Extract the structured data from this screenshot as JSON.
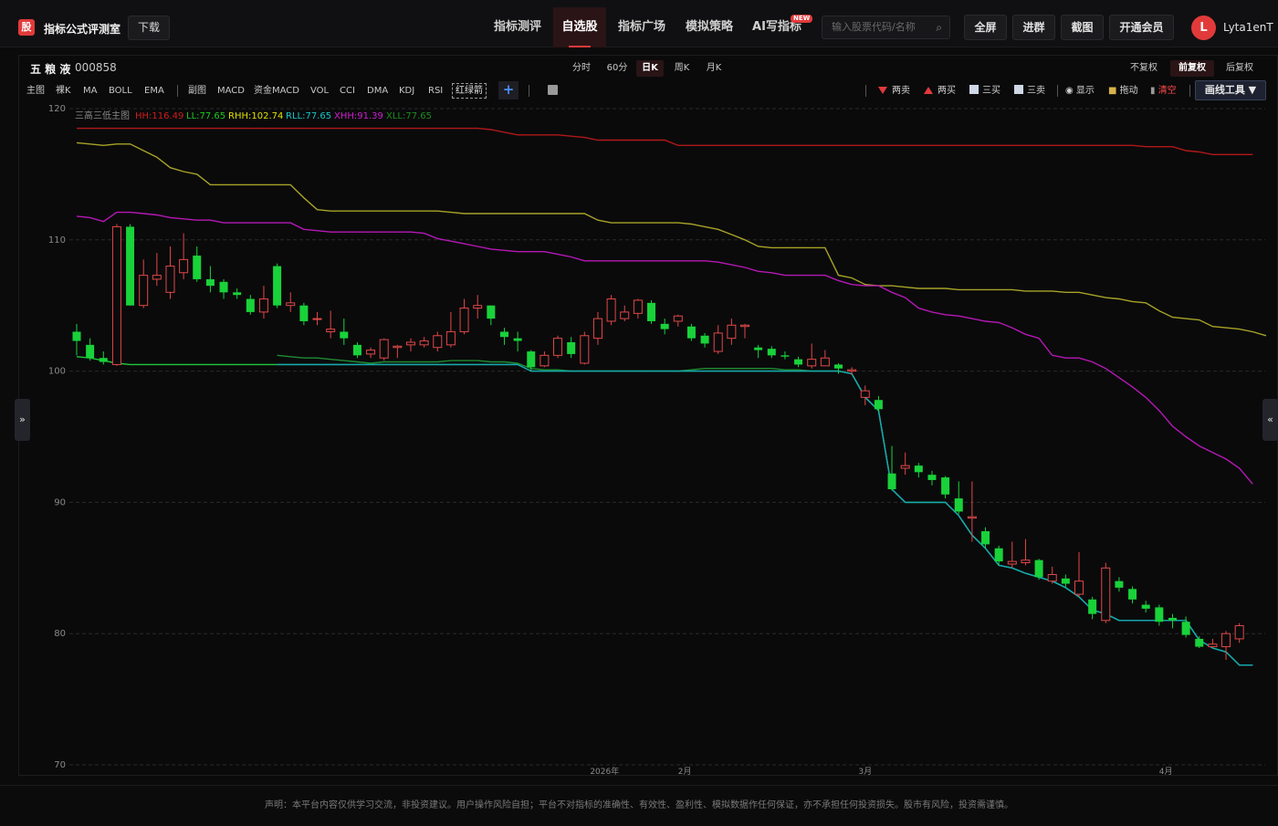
{
  "app": {
    "brand": "指标公式评测室",
    "logo_char": "股",
    "download": "下载"
  },
  "nav": [
    "指标测评",
    "自选股",
    "指标广场",
    "模拟策略",
    "AI写指标"
  ],
  "nav_active": "自选股",
  "new_badge": "NEW",
  "search": {
    "placeholder": "输入股票代码/名称"
  },
  "top_buttons": [
    "全屏",
    "进群",
    "截图",
    "开通会员"
  ],
  "user": {
    "avatar": "L",
    "name": "Lyta1enT"
  },
  "stock": {
    "name": "五 粮 液",
    "code": "000858"
  },
  "periods": [
    "分时",
    "60分",
    "日K",
    "周K",
    "月K"
  ],
  "period_active": "日K",
  "adjust": [
    "不复权",
    "前复权",
    "后复权"
  ],
  "adjust_active": "前复权",
  "indicators": [
    "主图",
    "裸K",
    "MA",
    "BOLL",
    "EMA",
    "副图",
    "MACD",
    "资金MACD",
    "VOL",
    "CCI",
    "DMA",
    "KDJ",
    "RSI",
    "红绿箭"
  ],
  "signals": [
    "两卖",
    "两买",
    "三买",
    "三卖",
    "显示",
    "拖动",
    "清空"
  ],
  "draw_tool": "画线工具 ▼",
  "side_left": "»",
  "side_right": "«",
  "legend": {
    "title": "三高三低主图",
    "items": [
      {
        "label": "HH:116.49",
        "color": "#d01c1c"
      },
      {
        "label": "LL:77.65",
        "color": "#1ec81e"
      },
      {
        "label": "RHH:102.74",
        "color": "#e0e000"
      },
      {
        "label": "RLL:77.65",
        "color": "#14c8c8"
      },
      {
        "label": "XHH:91.39",
        "color": "#d21ed2"
      },
      {
        "label": "XLL:77.65",
        "color": "#1e8c1e"
      }
    ]
  },
  "chart_data": {
    "type": "candlestick",
    "ylim": [
      70,
      120
    ],
    "y_ticks": [
      120,
      110,
      100,
      90,
      80,
      70
    ],
    "x_ticks": [
      {
        "label": "2026年",
        "index": 39.5
      },
      {
        "label": "2月",
        "index": 45.5
      },
      {
        "label": "3月",
        "index": 59
      },
      {
        "label": "4月",
        "index": 81.5
      }
    ],
    "candles": [
      [
        103.0,
        102.3,
        103.6,
        101.2
      ],
      [
        102.0,
        101.0,
        102.5,
        100.8
      ],
      [
        101.0,
        100.7,
        101.5,
        100.5
      ],
      [
        100.5,
        111.0,
        111.2,
        100.4
      ],
      [
        111.0,
        105.0,
        111.2,
        105.0
      ],
      [
        105.0,
        107.3,
        108.5,
        104.8
      ],
      [
        107.0,
        107.3,
        109.0,
        106.5
      ],
      [
        106.0,
        108.0,
        109.5,
        105.5
      ],
      [
        107.5,
        108.5,
        110.5,
        107.0
      ],
      [
        108.8,
        107.0,
        109.5,
        106.8
      ],
      [
        107.0,
        106.5,
        108.0,
        106.0
      ],
      [
        106.8,
        106.0,
        107.0,
        105.5
      ],
      [
        106.0,
        105.8,
        106.3,
        105.5
      ],
      [
        105.5,
        104.5,
        105.8,
        104.3
      ],
      [
        104.5,
        105.5,
        106.5,
        104.0
      ],
      [
        108.0,
        105.0,
        108.2,
        104.8
      ],
      [
        105.0,
        105.2,
        106.0,
        104.5
      ],
      [
        105.0,
        103.8,
        105.2,
        103.5
      ],
      [
        104.0,
        104.0,
        104.5,
        103.5
      ],
      [
        103.0,
        103.2,
        104.6,
        102.5
      ],
      [
        103.0,
        102.5,
        104.0,
        102.0
      ],
      [
        102.0,
        101.2,
        102.2,
        101.0
      ],
      [
        101.3,
        101.6,
        101.8,
        101.0
      ],
      [
        101.0,
        102.4,
        102.5,
        100.8
      ],
      [
        101.8,
        101.9,
        102.0,
        101.0
      ],
      [
        102.0,
        102.2,
        102.5,
        101.5
      ],
      [
        102.0,
        102.3,
        102.6,
        101.8
      ],
      [
        101.8,
        102.7,
        103.0,
        101.5
      ],
      [
        102.0,
        103.0,
        104.5,
        101.8
      ],
      [
        103.0,
        104.8,
        105.5,
        102.8
      ],
      [
        104.8,
        105.0,
        105.8,
        104.0
      ],
      [
        105.0,
        104.0,
        105.0,
        103.5
      ],
      [
        103.0,
        102.6,
        103.3,
        102.0
      ],
      [
        102.5,
        102.3,
        103.0,
        101.5
      ],
      [
        101.5,
        100.3,
        101.6,
        100.0
      ],
      [
        100.4,
        101.2,
        101.5,
        100.3
      ],
      [
        101.2,
        102.5,
        102.7,
        101.0
      ],
      [
        102.2,
        101.3,
        102.6,
        101.0
      ],
      [
        100.6,
        102.7,
        103.0,
        100.5
      ],
      [
        102.5,
        104.0,
        104.5,
        102.0
      ],
      [
        103.8,
        105.5,
        105.8,
        103.5
      ],
      [
        104.0,
        104.5,
        105.0,
        103.8
      ],
      [
        104.4,
        105.4,
        105.5,
        104.0
      ],
      [
        105.2,
        103.8,
        105.4,
        103.6
      ],
      [
        103.6,
        103.2,
        104.0,
        102.8
      ],
      [
        103.8,
        104.2,
        104.3,
        103.4
      ],
      [
        103.4,
        102.5,
        103.6,
        102.3
      ],
      [
        102.7,
        102.1,
        102.9,
        101.8
      ],
      [
        101.5,
        102.9,
        103.5,
        101.3
      ],
      [
        102.5,
        103.5,
        104.0,
        102.0
      ],
      [
        103.4,
        103.5,
        103.6,
        102.5
      ],
      [
        101.8,
        101.6,
        102.0,
        101.0
      ],
      [
        101.7,
        101.2,
        101.9,
        101.0
      ],
      [
        101.2,
        101.1,
        101.5,
        100.9
      ],
      [
        100.9,
        100.5,
        101.1,
        100.3
      ],
      [
        100.4,
        100.9,
        102.1,
        100.2
      ],
      [
        100.4,
        101.0,
        101.6,
        100.4
      ],
      [
        100.5,
        100.2,
        100.6,
        99.8
      ],
      [
        100.0,
        100.1,
        100.3,
        99.7
      ],
      [
        98.0,
        98.5,
        98.9,
        97.4
      ],
      [
        97.8,
        97.1,
        98.1,
        96.9
      ],
      [
        92.2,
        91.0,
        94.3,
        90.9
      ],
      [
        92.6,
        92.8,
        93.8,
        92.1
      ],
      [
        92.8,
        92.3,
        93.0,
        91.9
      ],
      [
        92.1,
        91.7,
        92.4,
        91.3
      ],
      [
        91.9,
        90.6,
        92.0,
        90.3
      ],
      [
        90.3,
        89.3,
        91.6,
        89.1
      ],
      [
        88.8,
        88.9,
        91.6,
        87.0
      ],
      [
        87.8,
        86.8,
        88.1,
        86.5
      ],
      [
        86.5,
        85.5,
        86.7,
        85.2
      ],
      [
        85.3,
        85.5,
        87.0,
        85.0
      ],
      [
        85.4,
        85.6,
        87.2,
        85.2
      ],
      [
        85.6,
        84.3,
        85.7,
        84.1
      ],
      [
        84.0,
        84.5,
        85.1,
        83.8
      ],
      [
        84.2,
        83.8,
        84.5,
        83.5
      ],
      [
        83.0,
        84.0,
        86.2,
        82.8
      ],
      [
        82.6,
        81.5,
        82.8,
        81.1
      ],
      [
        81.0,
        85.0,
        85.4,
        80.8
      ],
      [
        84.0,
        83.5,
        84.3,
        83.2
      ],
      [
        83.4,
        82.6,
        83.6,
        82.3
      ],
      [
        82.2,
        81.9,
        82.5,
        81.6
      ],
      [
        82.0,
        80.9,
        82.2,
        80.6
      ],
      [
        81.2,
        81.0,
        81.5,
        80.4
      ],
      [
        80.9,
        79.9,
        81.3,
        79.7
      ],
      [
        79.6,
        79.0,
        79.8,
        78.9
      ],
      [
        79.0,
        79.2,
        79.6,
        79.0
      ],
      [
        79.0,
        80.0,
        80.2,
        78.0
      ],
      [
        79.6,
        80.6,
        80.8,
        79.3
      ]
    ],
    "lines": [
      {
        "name": "HH",
        "color": "#b01818",
        "values": [
          118.5,
          118.5,
          118.5,
          118.5,
          118.5,
          118.5,
          118.5,
          118.5,
          118.5,
          118.5,
          118.5,
          118.5,
          118.5,
          118.5,
          118.5,
          118.5,
          118.5,
          118.5,
          118.5,
          118.5,
          118.5,
          118.5,
          118.5,
          118.5,
          118.5,
          118.5,
          118.5,
          118.5,
          118.5,
          118.5,
          118.5,
          118.4,
          118.2,
          118.0,
          118.0,
          118.0,
          118.0,
          117.9,
          117.8,
          117.6,
          117.6,
          117.6,
          117.6,
          117.6,
          117.6,
          117.2,
          117.2,
          117.2,
          117.2,
          117.2,
          117.2,
          117.2,
          117.2,
          117.2,
          117.2,
          117.2,
          117.2,
          117.2,
          117.2,
          117.2,
          117.2,
          117.2,
          117.2,
          117.2,
          117.2,
          117.2,
          117.2,
          117.2,
          117.2,
          117.2,
          117.2,
          117.2,
          117.2,
          117.2,
          117.2,
          117.2,
          117.2,
          117.2,
          117.2,
          117.2,
          117.1,
          117.1,
          117.1,
          116.8,
          116.7,
          116.5,
          116.5,
          116.5,
          116.5
        ]
      },
      {
        "name": "RHH",
        "color": "#a7a326",
        "values": [
          117.4,
          117.3,
          117.2,
          117.3,
          117.3,
          116.8,
          116.3,
          115.5,
          115.2,
          115.0,
          114.2,
          114.2,
          114.2,
          114.2,
          114.2,
          114.2,
          114.2,
          113.2,
          112.3,
          112.2,
          112.2,
          112.2,
          112.2,
          112.2,
          112.2,
          112.2,
          112.2,
          112.2,
          112.1,
          112.0,
          112.0,
          112.0,
          112.0,
          112.0,
          112.0,
          112.0,
          112.0,
          112.0,
          112.0,
          111.5,
          111.3,
          111.3,
          111.3,
          111.3,
          111.3,
          111.3,
          111.2,
          111.0,
          110.8,
          110.4,
          110.0,
          109.5,
          109.4,
          109.4,
          109.4,
          109.4,
          109.4,
          107.3,
          107.1,
          106.6,
          106.5,
          106.5,
          106.4,
          106.3,
          106.3,
          106.3,
          106.2,
          106.2,
          106.2,
          106.2,
          106.2,
          106.1,
          106.1,
          106.1,
          106.0,
          106.0,
          105.8,
          105.6,
          105.5,
          105.3,
          105.2,
          104.6,
          104.1,
          104.0,
          103.9,
          103.4,
          103.3,
          103.2,
          103.0,
          102.7
        ]
      },
      {
        "name": "XHH",
        "color": "#b518b5",
        "values": [
          111.8,
          111.7,
          111.4,
          112.1,
          112.1,
          112.0,
          111.9,
          111.7,
          111.6,
          111.5,
          111.5,
          111.3,
          111.3,
          111.3,
          111.3,
          111.3,
          111.3,
          110.8,
          110.7,
          110.6,
          110.6,
          110.6,
          110.6,
          110.6,
          110.6,
          110.6,
          110.5,
          110.1,
          109.9,
          109.7,
          109.5,
          109.3,
          109.2,
          109.1,
          109.1,
          109.1,
          108.9,
          108.7,
          108.4,
          108.4,
          108.4,
          108.4,
          108.4,
          108.4,
          108.4,
          108.4,
          108.4,
          108.4,
          108.3,
          108.1,
          107.9,
          107.6,
          107.5,
          107.3,
          107.3,
          107.3,
          107.3,
          106.9,
          106.6,
          106.5,
          106.5,
          106.0,
          105.6,
          104.8,
          104.5,
          104.3,
          104.2,
          104.0,
          103.8,
          103.7,
          103.3,
          102.8,
          102.5,
          101.2,
          101.0,
          101.0,
          100.7,
          100.2,
          99.5,
          98.8,
          98.0,
          97.0,
          95.8,
          95.0,
          94.3,
          93.8,
          93.3,
          92.6,
          91.4
        ]
      },
      {
        "name": "LL",
        "color": "#1ec83c",
        "values": [
          101.1,
          101.0,
          100.8,
          100.6,
          100.5,
          100.5,
          100.5,
          100.5,
          100.5,
          100.5,
          100.5,
          100.5,
          100.5,
          100.5,
          100.5,
          100.5,
          100.5,
          100.5,
          100.5,
          100.5,
          100.5,
          100.5,
          100.5,
          100.5,
          100.5,
          100.5,
          100.5,
          100.5,
          100.5,
          100.5,
          100.5,
          100.5,
          100.5,
          100.5,
          100.0,
          100.0,
          100.0,
          100.0,
          100.0,
          100.0,
          100.0,
          100.0,
          100.0,
          100.0,
          100.0,
          100.0,
          100.0,
          100.0,
          100.0,
          100.0,
          100.0,
          100.0,
          100.0,
          100.0,
          100.0,
          100.0,
          100.0,
          100.0,
          99.8,
          98.0,
          97.0,
          91.0,
          90.0,
          90.0,
          90.0,
          90.0,
          89.0,
          87.5,
          86.5,
          85.2,
          85.0,
          84.6,
          84.3,
          84.0,
          83.5,
          82.8,
          81.8,
          81.5,
          81.0,
          81.0,
          81.0,
          81.0,
          81.0,
          81.0,
          79.5,
          78.9,
          78.6,
          77.6,
          77.6
        ]
      },
      {
        "name": "XLL",
        "color": "#1f8c33",
        "values": [
          null,
          null,
          null,
          null,
          null,
          null,
          null,
          null,
          null,
          null,
          null,
          null,
          null,
          null,
          null,
          101.2,
          101.1,
          101.0,
          101.0,
          100.9,
          100.8,
          100.7,
          100.6,
          100.7,
          100.7,
          100.7,
          100.7,
          100.7,
          100.8,
          100.8,
          100.8,
          100.7,
          100.7,
          100.6,
          100.2,
          100.1,
          100.1,
          100.0,
          100.0,
          100.0,
          100.0,
          100.0,
          100.0,
          100.0,
          100.0,
          100.0,
          100.1,
          100.2,
          100.2,
          100.2,
          100.2,
          100.2,
          100.2,
          100.1,
          100.1,
          100.0,
          100.0,
          100.0,
          99.8,
          98.0,
          97.0,
          91.0,
          90.0,
          90.0,
          90.0,
          90.0,
          89.0,
          87.5,
          86.5,
          85.2,
          85.0,
          84.6,
          84.3,
          84.0,
          83.5,
          82.8,
          81.8,
          81.5,
          81.0,
          81.0,
          81.0,
          81.0,
          81.0,
          81.0,
          79.5,
          78.9,
          78.6,
          77.6,
          77.6
        ]
      },
      {
        "name": "RLL",
        "color": "#16a8b8",
        "values": [
          null,
          null,
          null,
          null,
          null,
          null,
          null,
          null,
          null,
          null,
          null,
          null,
          null,
          null,
          null,
          100.5,
          100.5,
          100.5,
          100.5,
          100.5,
          100.5,
          100.5,
          100.5,
          100.5,
          100.5,
          100.5,
          100.5,
          100.5,
          100.5,
          100.5,
          100.5,
          100.5,
          100.5,
          100.5,
          100.0,
          100.0,
          100.0,
          100.0,
          100.0,
          100.0,
          100.0,
          100.0,
          100.0,
          100.0,
          100.0,
          100.0,
          100.0,
          100.0,
          100.0,
          100.0,
          100.0,
          100.0,
          100.0,
          100.0,
          100.0,
          100.0,
          100.0,
          100.0,
          99.8,
          98.0,
          97.0,
          91.0,
          90.0,
          90.0,
          90.0,
          90.0,
          89.0,
          87.5,
          86.5,
          85.2,
          85.0,
          84.6,
          84.3,
          84.0,
          83.5,
          82.8,
          81.8,
          81.5,
          81.0,
          81.0,
          81.0,
          81.0,
          81.0,
          81.0,
          79.5,
          78.9,
          78.6,
          77.6,
          77.6
        ]
      }
    ]
  },
  "footer": "声明：本平台内容仅供学习交流，非投资建议。用户操作风险自担；平台不对指标的准确性、有效性、盈利性、模拟数据作任何保证，亦不承担任何投资损失。股市有风险，投资需谨慎。"
}
